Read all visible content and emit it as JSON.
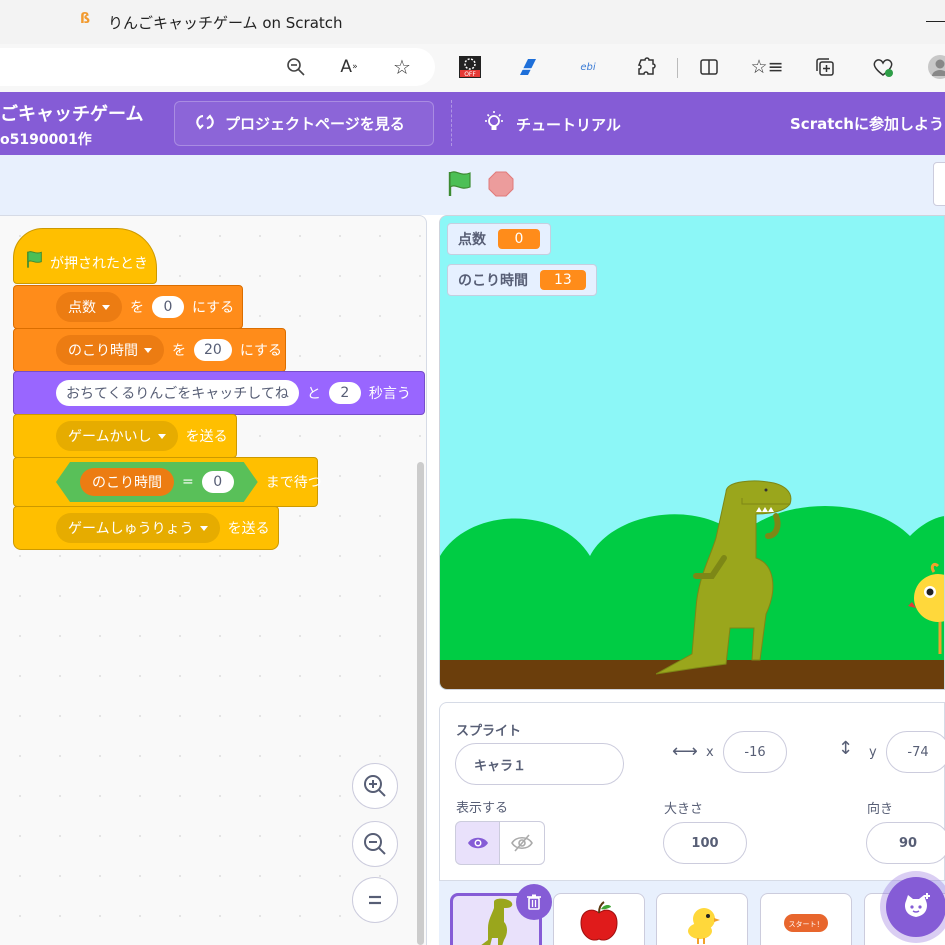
{
  "browser": {
    "tab_title": "りんごキャッチゲーム on Scratch",
    "favicon": "scratch-favicon",
    "toolbar_icons": [
      "zoom-out-icon",
      "read-aloud-icon",
      "favorite-star-icon",
      "extension-off-icon",
      "extension-pen-icon",
      "extension-ebi-icon",
      "extensions-icon",
      "split-screen-icon",
      "favorites-icon",
      "collections-icon",
      "browser-health-icon",
      "profile-avatar-icon"
    ],
    "ebi_label": "ebi"
  },
  "menubar": {
    "project_title": "ごキャッチゲーム",
    "project_author": "o5190001作",
    "project_page_button": "プロジェクトページを見る",
    "tutorial_button": "チュートリアル",
    "join_button": "Scratchに参加しよう",
    "bg_color": "#855cd6"
  },
  "code": {
    "hat": "が押されたとき",
    "set_score": {
      "var": "点数",
      "to": "を",
      "value": "0",
      "action": "にする"
    },
    "set_time": {
      "var": "のこり時間",
      "to": "を",
      "value": "20",
      "action": "にする"
    },
    "say": {
      "message": "おちてくるりんごをキャッチしてね",
      "and": "と",
      "secs": "2",
      "action": "秒言う"
    },
    "broadcast_start": {
      "message": "ゲームかいし",
      "action": "を送る"
    },
    "wait_until": {
      "var": "のこり時間",
      "op": "=",
      "value": "0",
      "action": "まで待つ"
    },
    "broadcast_end": {
      "message": "ゲームしゅうりょう",
      "action": "を送る"
    }
  },
  "stage": {
    "monitors": [
      {
        "label": "点数",
        "value": "0"
      },
      {
        "label": "のこり時間",
        "value": "13"
      }
    ],
    "sky_color": "#8cf7f7",
    "hill_color": "#00cc44",
    "ground_color": "#6b3e0c"
  },
  "sprite_info": {
    "sprite_label": "スプライト",
    "sprite_name": "キャラ１",
    "x_label": "x",
    "x_value": "-16",
    "y_label": "y",
    "y_value": "-74",
    "show_label": "表示する",
    "size_label": "大きさ",
    "size_value": "100",
    "direction_label": "向き",
    "direction_value": "90"
  },
  "sprites": [
    {
      "name": "dinosaur-sprite",
      "selected": true
    },
    {
      "name": "apple-sprite"
    },
    {
      "name": "chick-sprite"
    },
    {
      "name": "start-button-sprite",
      "label": "スタート！"
    },
    {
      "name": "more-sprite"
    }
  ]
}
